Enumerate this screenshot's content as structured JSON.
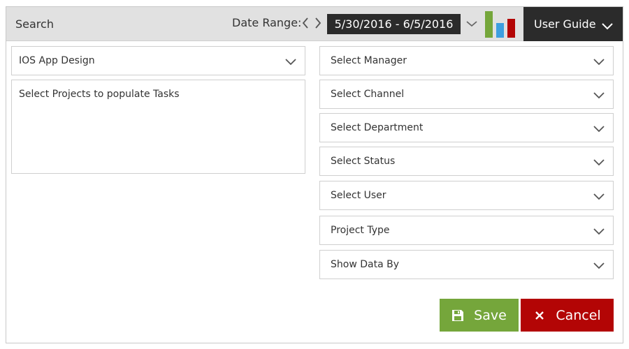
{
  "header": {
    "title": "Search",
    "date_range_label": "Date Range:",
    "date_range_value": "5/30/2016 - 6/5/2016",
    "user_guide_label": "User Guide"
  },
  "left": {
    "project_select": "IOS App Design",
    "tasks_message": "Select Projects to populate Tasks"
  },
  "filters": [
    "Select Manager",
    "Select Channel",
    "Select Department",
    "Select Status",
    "Select User",
    "Project Type",
    "Show Data By"
  ],
  "actions": {
    "save_label": "Save",
    "cancel_label": "Cancel"
  },
  "colors": {
    "header_bg": "#e1e1e1",
    "dark": "#2b2b2b",
    "save": "#75a63b",
    "cancel": "#b30505",
    "chart_green": "#75a63b",
    "chart_blue": "#3d9fe0",
    "chart_red": "#b30505"
  },
  "icons": [
    "chevron-left-icon",
    "chevron-right-icon",
    "chevron-down-icon",
    "bar-chart-icon",
    "floppy-disk-icon",
    "close-icon"
  ]
}
